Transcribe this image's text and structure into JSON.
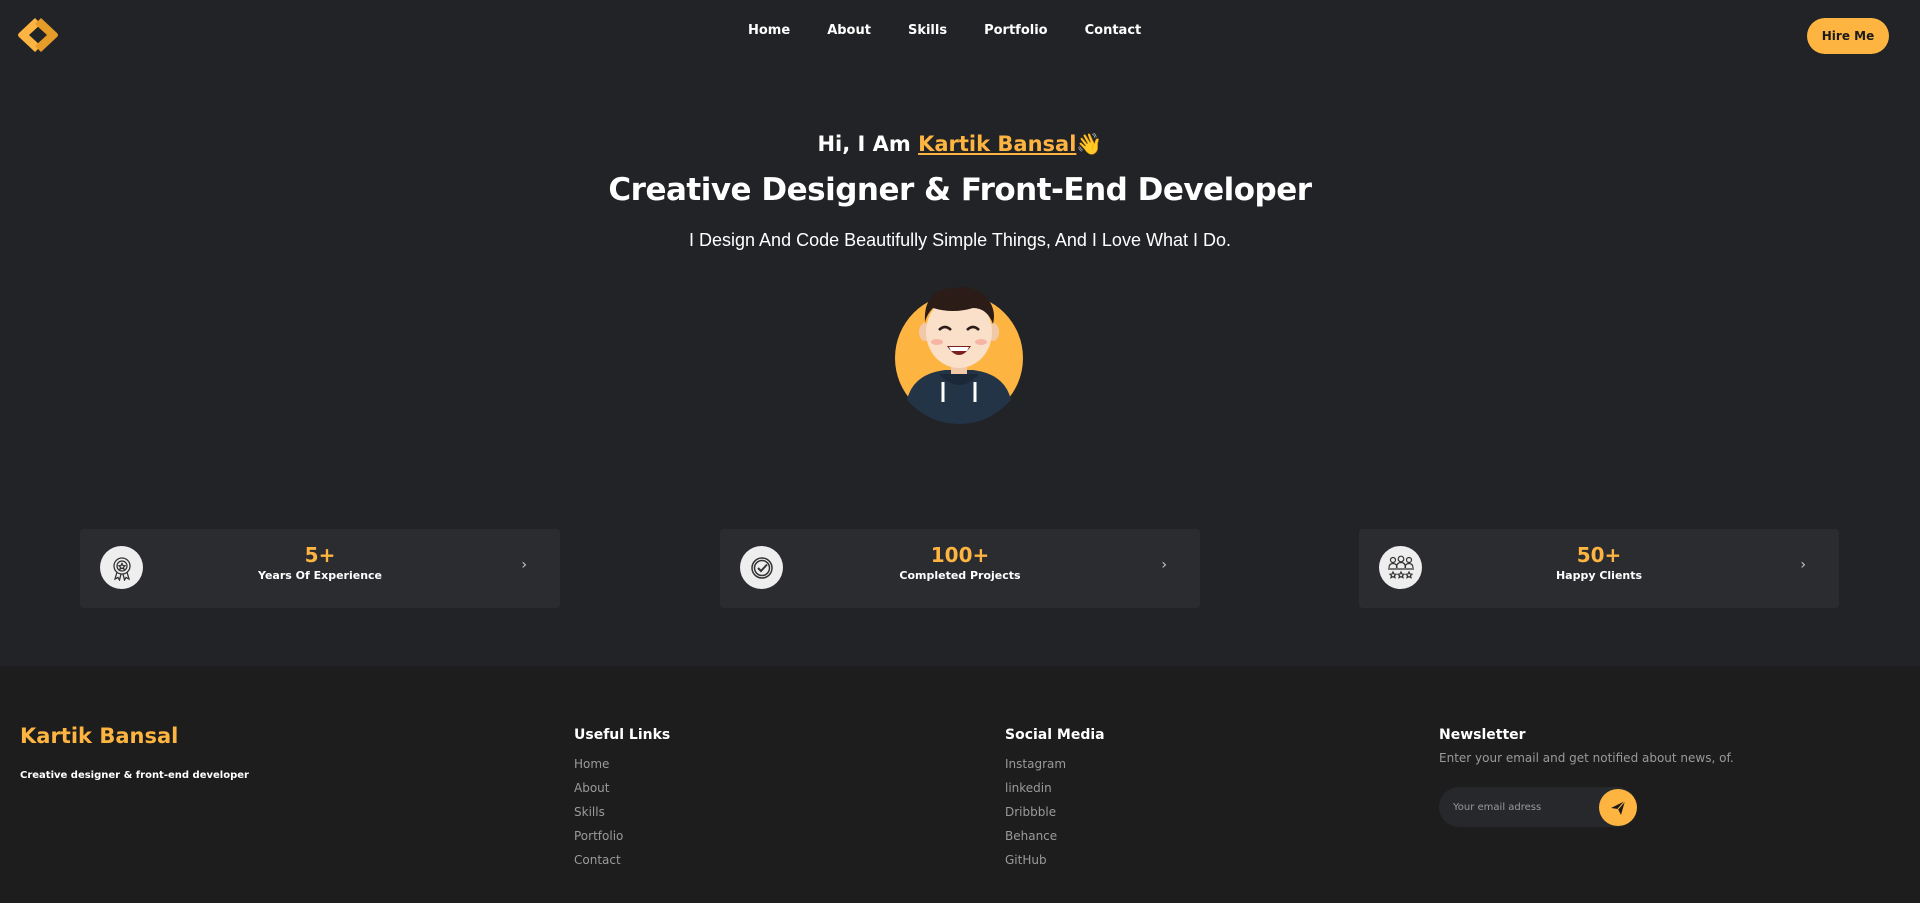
{
  "nav": {
    "links": [
      "Home",
      "About",
      "Skills",
      "Portfolio",
      "Contact"
    ],
    "cta": "Hire Me"
  },
  "hero": {
    "greeting_prefix": "Hi, I Am ",
    "name": "Kartik Bansal",
    "wave": "👋",
    "title": "Creative Designer & Front-End Developer",
    "subtitle": "I Design And Code Beautifully Simple Things, And I Love What I Do."
  },
  "stats": [
    {
      "icon": "award-icon",
      "value": "5+",
      "label": "Years Of Experience",
      "arrow": "›"
    },
    {
      "icon": "check-circle-icon",
      "value": "100+",
      "label": "Completed Projects",
      "arrow": "›"
    },
    {
      "icon": "users-icon",
      "value": "50+",
      "label": "Happy Clients",
      "arrow": "›"
    }
  ],
  "footer": {
    "brand": "Kartik Bansal",
    "tagline": "Creative designer & front-end developer",
    "useful_links": {
      "heading": "Useful Links",
      "items": [
        "Home",
        "About",
        "Skills",
        "Portfolio",
        "Contact"
      ]
    },
    "social": {
      "heading": "Social Media",
      "items": [
        "Instagram",
        "linkedin",
        "Dribbble",
        "Behance",
        "GitHub"
      ]
    },
    "newsletter": {
      "heading": "Newsletter",
      "description": "Enter your email and get notified about news, of.",
      "placeholder": "Your email adress"
    }
  },
  "colors": {
    "accent": "#fdb441",
    "background": "#222326",
    "card": "#2b2c30",
    "footer": "#1d1d1d"
  }
}
